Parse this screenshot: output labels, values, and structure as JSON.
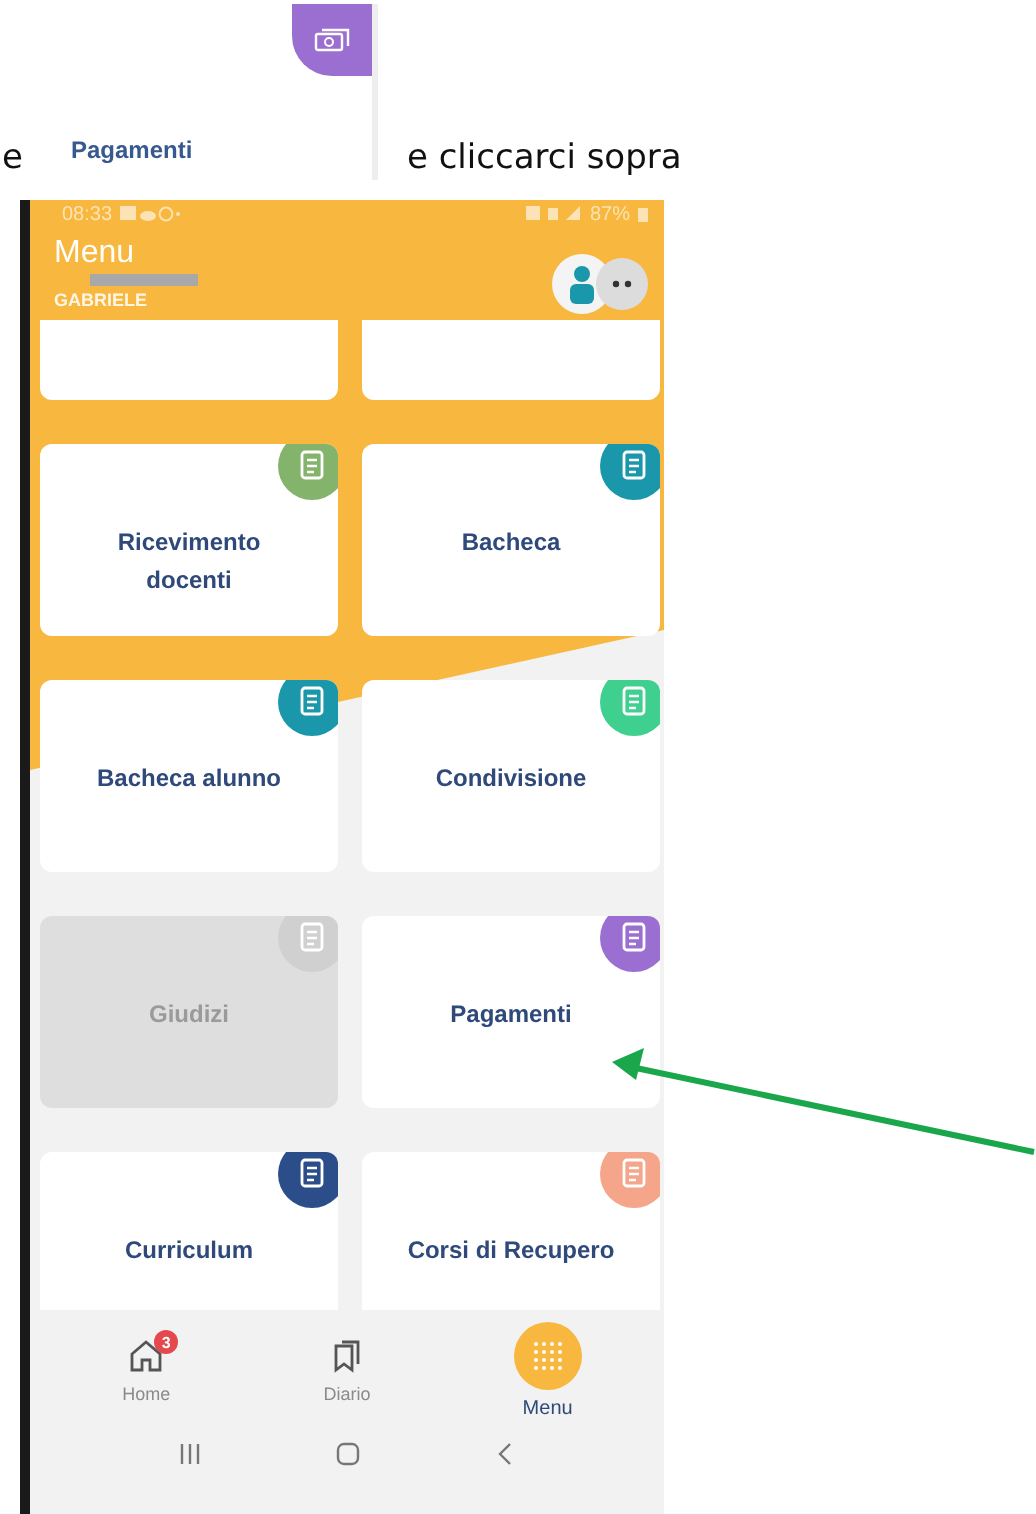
{
  "instruction": {
    "prefix": "e",
    "chip_label": "Pagamenti",
    "suffix": "e cliccarci sopra"
  },
  "status_bar": {
    "time": "08:33",
    "battery": "87%"
  },
  "header": {
    "title": "Menu",
    "user": "GABRIELE"
  },
  "tiles": [
    {
      "kind": "blank"
    },
    {
      "kind": "blank"
    },
    {
      "kind": "tile",
      "label": "Ricevimento docenti",
      "color": "#84b36c",
      "disabled": false
    },
    {
      "kind": "tile",
      "label": "Bacheca",
      "color": "#1a97aa",
      "disabled": false
    },
    {
      "kind": "tile",
      "label": "Bacheca alunno",
      "color": "#1a97aa",
      "disabled": false
    },
    {
      "kind": "tile",
      "label": "Condivisione",
      "color": "#3fcf8e",
      "disabled": false
    },
    {
      "kind": "tile",
      "label": "Giudizi",
      "color": "#d0d0d0",
      "disabled": true
    },
    {
      "kind": "tile",
      "label": "Pagamenti",
      "color": "#9b6fd1",
      "disabled": false
    },
    {
      "kind": "tile",
      "label": "Curriculum",
      "color": "#2b4d8a",
      "disabled": false
    },
    {
      "kind": "tile",
      "label": "Corsi di Recupero",
      "color": "#f4a58a",
      "disabled": false
    }
  ],
  "nav": [
    {
      "kind": "home",
      "label": "Home",
      "badge": "3",
      "selected": false
    },
    {
      "kind": "diary",
      "label": "Diario",
      "selected": false
    },
    {
      "kind": "grid",
      "label": "Menu",
      "selected": true
    }
  ]
}
